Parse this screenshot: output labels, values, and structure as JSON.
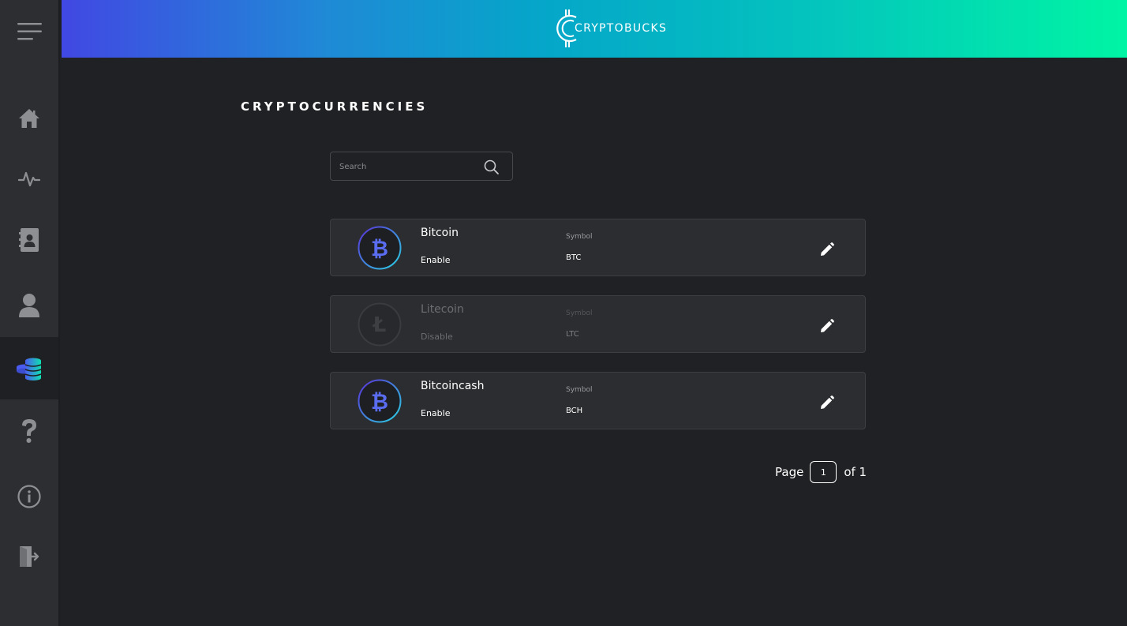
{
  "app": {
    "logo_prefix": "CRYPTO",
    "logo_suffix": "BUCKS"
  },
  "sidebar": {
    "items": [
      {
        "name": "home",
        "icon": "home-icon"
      },
      {
        "name": "activity",
        "icon": "activity-icon"
      },
      {
        "name": "contacts",
        "icon": "contact-book-icon"
      },
      {
        "name": "account",
        "icon": "user-icon"
      },
      {
        "name": "cryptocurrencies",
        "icon": "coins-icon",
        "active": true
      },
      {
        "name": "help",
        "icon": "question-icon"
      },
      {
        "name": "info",
        "icon": "info-icon"
      },
      {
        "name": "logout",
        "icon": "logout-icon"
      }
    ]
  },
  "page": {
    "title": "CRYPTOCURRENCIES"
  },
  "search": {
    "placeholder": "Search",
    "value": ""
  },
  "currencies": [
    {
      "name": "Bitcoin",
      "status": "Enable",
      "symbol_label": "Symbol",
      "symbol": "BTC",
      "icon": "bitcoin-icon"
    },
    {
      "name": "Litecoin",
      "status": "Disable",
      "symbol_label": "Symbol",
      "symbol": "LTC",
      "icon": "litecoin-icon"
    },
    {
      "name": "Bitcoincash",
      "status": "Enable",
      "symbol_label": "Symbol",
      "symbol": "BCH",
      "icon": "bitcoin-icon"
    }
  ],
  "pagination": {
    "page_label": "Page",
    "current": "1",
    "of_label": "of 1"
  },
  "colors": {
    "background": "#202124",
    "sidebar": "#2d2e31",
    "card": "#2c2d30",
    "gradient_start": "#4148e3",
    "gradient_end": "#00f5a4",
    "coin_blue": "#5a6cf0"
  }
}
